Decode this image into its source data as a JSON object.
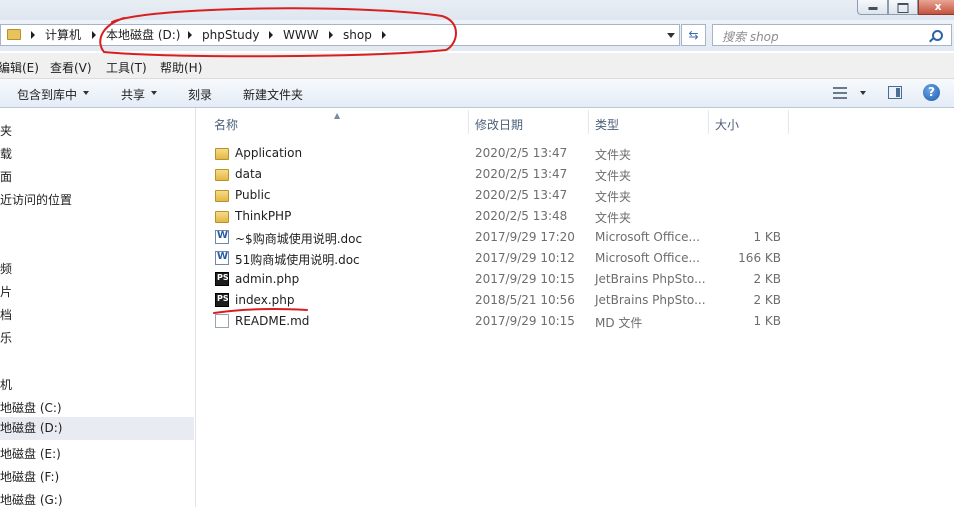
{
  "window": {
    "close_glyph": "x"
  },
  "address": {
    "crumbs": [
      "计算机",
      "本地磁盘 (D:)",
      "phpStudy",
      "WWW",
      "shop"
    ],
    "search_placeholder": "搜索 shop"
  },
  "menu": {
    "items": [
      "编辑(E)",
      "查看(V)",
      "工具(T)",
      "帮助(H)"
    ]
  },
  "toolbar": {
    "include_library": "包含到库中",
    "share": "共享",
    "burn": "刻录",
    "new_folder": "新建文件夹",
    "help_glyph": "?"
  },
  "nav": {
    "items": [
      {
        "label": "夹",
        "selected": false
      },
      {
        "label": "载",
        "selected": false
      },
      {
        "label": "面",
        "selected": false
      },
      {
        "label": "近访问的位置",
        "selected": false
      },
      {
        "label": "频",
        "selected": false
      },
      {
        "label": "片",
        "selected": false
      },
      {
        "label": "档",
        "selected": false
      },
      {
        "label": "乐",
        "selected": false
      },
      {
        "label": "机",
        "selected": false
      },
      {
        "label": "地磁盘 (C:)",
        "selected": false
      },
      {
        "label": "地磁盘 (D:)",
        "selected": true
      },
      {
        "label": "地磁盘 (E:)",
        "selected": false
      },
      {
        "label": "地磁盘 (F:)",
        "selected": false
      },
      {
        "label": "地磁盘 (G:)",
        "selected": false
      }
    ]
  },
  "columns": {
    "name": "名称",
    "date": "修改日期",
    "type": "类型",
    "size": "大小"
  },
  "files": [
    {
      "name": "Application",
      "date": "2020/2/5 13:47",
      "type": "文件夹",
      "size": "",
      "icon": "folder-icon"
    },
    {
      "name": "data",
      "date": "2020/2/5 13:47",
      "type": "文件夹",
      "size": "",
      "icon": "folder-icon"
    },
    {
      "name": "Public",
      "date": "2020/2/5 13:47",
      "type": "文件夹",
      "size": "",
      "icon": "folder-icon"
    },
    {
      "name": "ThinkPHP",
      "date": "2020/2/5 13:48",
      "type": "文件夹",
      "size": "",
      "icon": "folder-icon"
    },
    {
      "name": "~$购商城使用说明.doc",
      "date": "2017/9/29 17:20",
      "type": "Microsoft Office...",
      "size": "1 KB",
      "icon": "word-doc-icon"
    },
    {
      "name": "51购商城使用说明.doc",
      "date": "2017/9/29 10:12",
      "type": "Microsoft Office...",
      "size": "166 KB",
      "icon": "word-doc-icon"
    },
    {
      "name": "admin.php",
      "date": "2017/9/29 10:15",
      "type": "JetBrains PhpSto...",
      "size": "2 KB",
      "icon": "phpstorm-file-icon"
    },
    {
      "name": "index.php",
      "date": "2018/5/21 10:56",
      "type": "JetBrains PhpSto...",
      "size": "2 KB",
      "icon": "phpstorm-file-icon"
    },
    {
      "name": "README.md",
      "date": "2017/9/29 10:15",
      "type": "MD 文件",
      "size": "1 KB",
      "icon": "text-file-icon"
    }
  ],
  "colors": {
    "annotation": "#d81e1e",
    "toolbar_bg": "#e4ecf6",
    "selected_bg": "#e8ecf2"
  }
}
